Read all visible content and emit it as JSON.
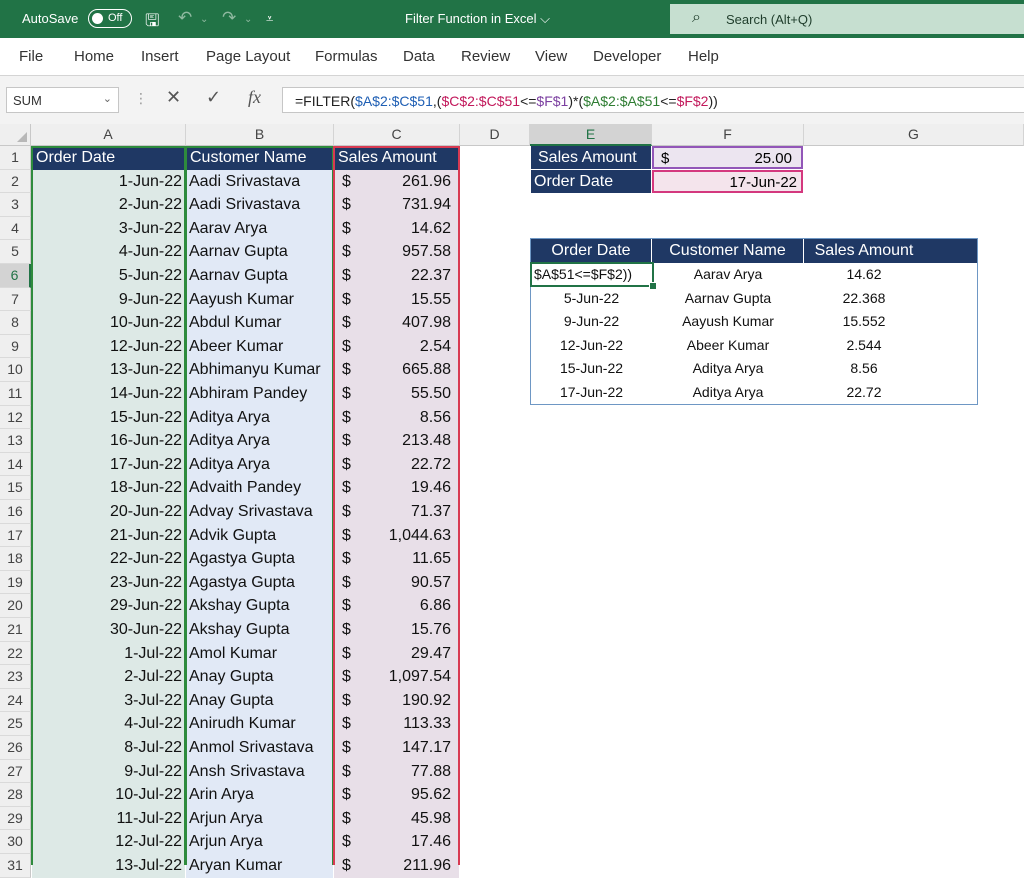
{
  "titlebar": {
    "autosave_label": "AutoSave",
    "toggle_state": "Off",
    "doc_title": "Filter Function in Excel ⌵",
    "search_placeholder": "Search (Alt+Q)"
  },
  "menu": {
    "items": [
      "File",
      "Home",
      "Insert",
      "Page Layout",
      "Formulas",
      "Data",
      "Review",
      "View",
      "Developer",
      "Help"
    ]
  },
  "formula_bar": {
    "name_box": "SUM",
    "formula_parts": [
      {
        "text": "=FILTER(",
        "color": "#222222"
      },
      {
        "text": "$A$2:$C$51",
        "color": "#1f5fb4"
      },
      {
        "text": ",(",
        "color": "#222222"
      },
      {
        "text": "$C$2:$C$51",
        "color": "#c2185b"
      },
      {
        "text": "<=",
        "color": "#222222"
      },
      {
        "text": "$F$1",
        "color": "#7b3fa0"
      },
      {
        "text": ")*(",
        "color": "#222222"
      },
      {
        "text": "$A$2:$A$51",
        "color": "#2e7d32"
      },
      {
        "text": "<=",
        "color": "#222222"
      },
      {
        "text": "$F$2",
        "color": "#c2185b"
      },
      {
        "text": "))",
        "color": "#222222"
      }
    ]
  },
  "sheet": {
    "column_headers": [
      "A",
      "B",
      "C",
      "D",
      "E",
      "F",
      "G"
    ],
    "selected_column": "E",
    "selected_row": "6",
    "row_numbers": [
      "1",
      "2",
      "3",
      "4",
      "5",
      "6",
      "7",
      "8",
      "9",
      "10",
      "11",
      "12",
      "13",
      "14",
      "15",
      "16",
      "17",
      "18",
      "19",
      "20",
      "21",
      "22",
      "23",
      "24",
      "25",
      "26",
      "27",
      "28",
      "29",
      "30",
      "31"
    ],
    "table_headers": [
      "Order Date",
      "Customer Name",
      "Sales Amount"
    ],
    "rows": [
      {
        "date": "1-Jun-22",
        "name": "Aadi Srivastava",
        "amount": "261.96"
      },
      {
        "date": "2-Jun-22",
        "name": "Aadi Srivastava",
        "amount": "731.94"
      },
      {
        "date": "3-Jun-22",
        "name": "Aarav Arya",
        "amount": "14.62"
      },
      {
        "date": "4-Jun-22",
        "name": "Aarnav Gupta",
        "amount": "957.58"
      },
      {
        "date": "5-Jun-22",
        "name": "Aarnav Gupta",
        "amount": "22.37"
      },
      {
        "date": "9-Jun-22",
        "name": "Aayush Kumar",
        "amount": "15.55"
      },
      {
        "date": "10-Jun-22",
        "name": "Abdul Kumar",
        "amount": "407.98"
      },
      {
        "date": "12-Jun-22",
        "name": "Abeer Kumar",
        "amount": "2.54"
      },
      {
        "date": "13-Jun-22",
        "name": "Abhimanyu Kumar",
        "amount": "665.88"
      },
      {
        "date": "14-Jun-22",
        "name": "Abhiram Pandey",
        "amount": "55.50"
      },
      {
        "date": "15-Jun-22",
        "name": "Aditya Arya",
        "amount": "8.56"
      },
      {
        "date": "16-Jun-22",
        "name": "Aditya Arya",
        "amount": "213.48"
      },
      {
        "date": "17-Jun-22",
        "name": "Aditya Arya",
        "amount": "22.72"
      },
      {
        "date": "18-Jun-22",
        "name": "Advaith Pandey",
        "amount": "19.46"
      },
      {
        "date": "20-Jun-22",
        "name": "Advay Srivastava",
        "amount": "71.37"
      },
      {
        "date": "21-Jun-22",
        "name": "Advik Gupta",
        "amount": "1,044.63"
      },
      {
        "date": "22-Jun-22",
        "name": "Agastya Gupta",
        "amount": "11.65"
      },
      {
        "date": "23-Jun-22",
        "name": "Agastya Gupta",
        "amount": "90.57"
      },
      {
        "date": "29-Jun-22",
        "name": "Akshay Gupta",
        "amount": "6.86"
      },
      {
        "date": "30-Jun-22",
        "name": "Akshay Gupta",
        "amount": "15.76"
      },
      {
        "date": "1-Jul-22",
        "name": "Amol Kumar",
        "amount": "29.47"
      },
      {
        "date": "2-Jul-22",
        "name": "Anay Gupta",
        "amount": "1,097.54"
      },
      {
        "date": "3-Jul-22",
        "name": "Anay Gupta",
        "amount": "190.92"
      },
      {
        "date": "4-Jul-22",
        "name": "Anirudh Kumar",
        "amount": "113.33"
      },
      {
        "date": "8-Jul-22",
        "name": "Anmol Srivastava",
        "amount": "147.17"
      },
      {
        "date": "9-Jul-22",
        "name": "Ansh Srivastava",
        "amount": "77.88"
      },
      {
        "date": "10-Jul-22",
        "name": "Arin Arya",
        "amount": "95.62"
      },
      {
        "date": "11-Jul-22",
        "name": "Arjun Arya",
        "amount": "45.98"
      },
      {
        "date": "12-Jul-22",
        "name": "Arjun Arya",
        "amount": "17.46"
      },
      {
        "date": "13-Jul-22",
        "name": "Aryan Kumar",
        "amount": "211.96"
      }
    ],
    "currency_symbol": "$",
    "criteria": {
      "sales_label": "Sales Amount",
      "sales_currency": "$",
      "sales_value": "25.00",
      "date_label": "Order Date",
      "date_value": "17-Jun-22"
    },
    "result_table": {
      "headers": [
        "Order Date",
        "Customer Name",
        "Sales Amount"
      ],
      "active_cell_text": "$A$51<=$F$2))",
      "rows": [
        {
          "date": "",
          "name": "Aarav Arya",
          "amount": "14.62"
        },
        {
          "date": "5-Jun-22",
          "name": "Aarnav Gupta",
          "amount": "22.368"
        },
        {
          "date": "9-Jun-22",
          "name": "Aayush Kumar",
          "amount": "15.552"
        },
        {
          "date": "12-Jun-22",
          "name": "Abeer Kumar",
          "amount": "2.544"
        },
        {
          "date": "15-Jun-22",
          "name": "Aditya Arya",
          "amount": "8.56"
        },
        {
          "date": "17-Jun-22",
          "name": "Aditya Arya",
          "amount": "22.72"
        }
      ]
    }
  }
}
